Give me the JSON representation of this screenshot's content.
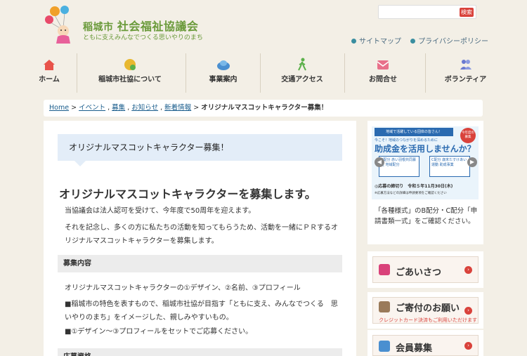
{
  "header": {
    "org_prefix": "稲城市",
    "org_name": "社会福祉協議会",
    "tagline": "ともに支えみんなでつくる思いやりのまち",
    "search_button": "検索",
    "util_links": [
      "サイトマップ",
      "プライバシーポリシー"
    ]
  },
  "nav": {
    "items": [
      {
        "label": "ホーム",
        "icon": "home-icon",
        "color": "#e8534a"
      },
      {
        "label": "稲城市社協について",
        "icon": "info-icon",
        "color": "#e8b830"
      },
      {
        "label": "事業案内",
        "icon": "cloud-icon",
        "color": "#4a8fd0"
      },
      {
        "label": "交通アクセス",
        "icon": "walk-icon",
        "color": "#5bb04a"
      },
      {
        "label": "お問合せ",
        "icon": "mail-icon",
        "color": "#e8708a"
      },
      {
        "label": "ボランティア",
        "icon": "people-icon",
        "color": "#6a7ad0"
      }
    ]
  },
  "breadcrumb": {
    "home": "Home",
    "items": [
      "イベント",
      "募集",
      "お知らせ",
      "新着情報"
    ],
    "current": "オリジナルマスコットキャラクター募集！"
  },
  "main": {
    "page_title": "オリジナルマスコットキャラクター募集！",
    "headline": "オリジナルマスコットキャラクターを募集します。",
    "intro1": "当協議会は法人認可を受けて、今年度で50周年を迎えます。",
    "intro2": "それを記念し、多くの方に私たちの活動を知ってもらうため、活動を一緒にＰＲするオリジナルマスコットキャラクターを募集します。",
    "section1_title": "募集内容",
    "sec1_line1": "オリジナルマスコットキャラクターの①デザイン、②名前、③プロフィール",
    "sec1_line2": "■稲城市の特色を表すもので、稲城市社協が目指す「ともに支え、みんなでつくる　思いやりのまち」をイメージした、親しみやすいもの。",
    "sec1_line3": "■①デザイン～③プロフィールをセットでご応募ください。",
    "section2_title": "応募資格"
  },
  "side": {
    "banner": {
      "top_text": "地域で活躍している団体の皆さん！",
      "sub_text": "今こそ！地域のつながりを深めるために",
      "title": "助成金を活用しませんか？",
      "badge": "今年度の募集",
      "card_b": "B配分 赤い羽根共同募金 地域配分",
      "card_c": "C配分 歳末たすけあい運動 助成事業",
      "deadline": "◎応募の締切り　令和５年11月30日(木)",
      "note": "※応募方法などの詳細は申請要項をご確認ください"
    },
    "caption": "「各種様式」のB配分・C配分「申請書類一式」をご確認ください。",
    "buttons": [
      {
        "label": "ごあいさつ",
        "icon": "greeting-icon",
        "color": "#d9427a",
        "sub": ""
      },
      {
        "label": "ご寄付のお願い",
        "icon": "handshake-icon",
        "color": "#9a7a5a",
        "sub": "クレジットカード決済もご利用いただけます"
      },
      {
        "label": "会員募集",
        "icon": "members-icon",
        "color": "#4a8fd0",
        "sub": ""
      }
    ]
  }
}
